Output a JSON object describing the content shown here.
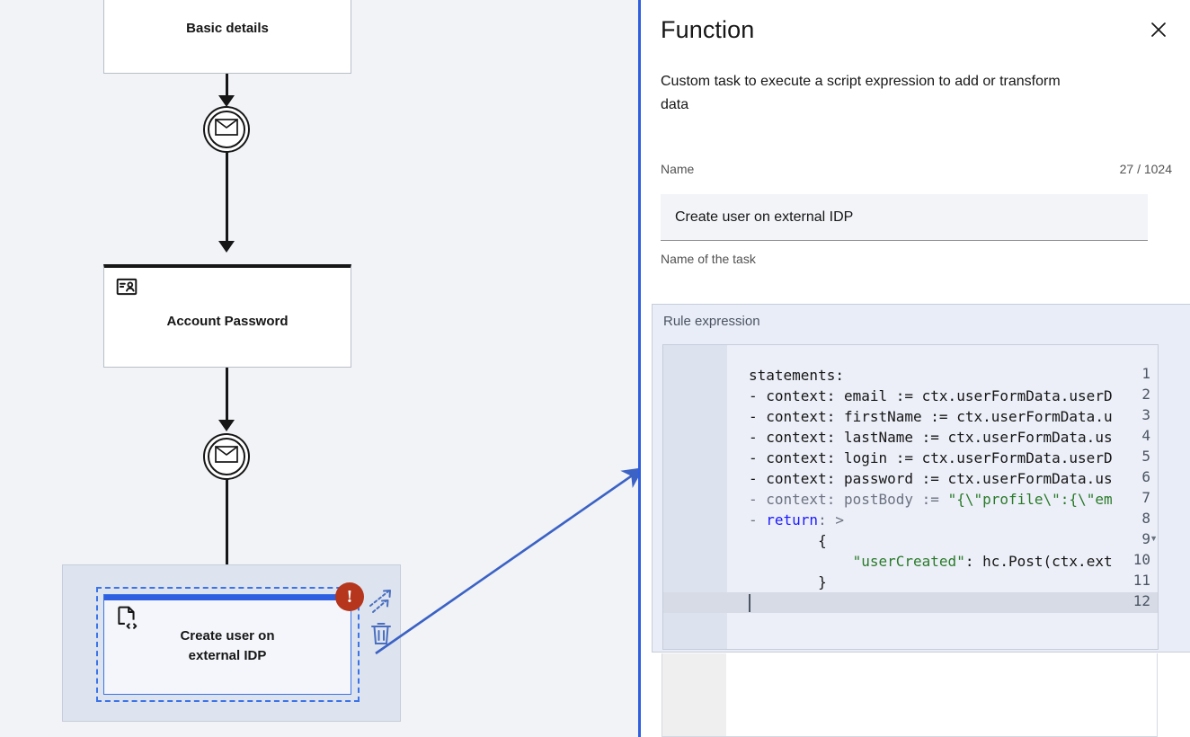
{
  "canvas": {
    "nodes": [
      {
        "id": "basic-details",
        "label": "Basic details",
        "icon": "user-task-icon"
      },
      {
        "id": "account-password",
        "label": "Account Password",
        "icon": "user-task-icon"
      },
      {
        "id": "create-user",
        "label": "Create user on\nexternal IDP",
        "label_line1": "Create user on",
        "label_line2": "external IDP",
        "icon": "script-task-icon"
      }
    ],
    "events": [
      {
        "id": "message-event-1",
        "icon": "envelope-icon"
      },
      {
        "id": "message-event-2",
        "icon": "envelope-icon"
      }
    ],
    "selected_node": {
      "error_badge": "!",
      "tools": [
        {
          "name": "connect-icon",
          "glyph": "connect"
        },
        {
          "name": "delete-icon",
          "glyph": "trash"
        }
      ]
    },
    "colors": {
      "background": "#f1f3f7",
      "selection_blue": "#3b73e8",
      "node_bar": "#2f5fe0",
      "error_red": "#b5361c",
      "tool_blue": "#4a6fbf"
    }
  },
  "panel": {
    "title": "Function",
    "close_label": "×",
    "description": "Custom task to execute a script expression to add or transform data",
    "name_field": {
      "label": "Name",
      "counter": "27 / 1024",
      "value": "Create user on external IDP",
      "placeholder": "",
      "helper": "Name of the task"
    },
    "rule_expression": {
      "label": "Rule expression",
      "active_line": 12,
      "lines": [
        {
          "n": 1,
          "text": "statements:",
          "fold": false
        },
        {
          "n": 2,
          "text": "- context: email := ctx.userFormData.userD",
          "fold": false
        },
        {
          "n": 3,
          "text": "- context: firstName := ctx.userFormData.u",
          "fold": false
        },
        {
          "n": 4,
          "text": "- context: lastName := ctx.userFormData.us",
          "fold": false
        },
        {
          "n": 5,
          "text": "- context: login := ctx.userFormData.userD",
          "fold": false
        },
        {
          "n": 6,
          "text": "- context: password := ctx.userFormData.us",
          "fold": false
        },
        {
          "n": 7,
          "text": "- context: postBody := \"{\\\"profile\\\":{\\\"em",
          "fold": false
        },
        {
          "n": 8,
          "text": "- return: >",
          "fold": false
        },
        {
          "n": 9,
          "text": "        {",
          "fold": true
        },
        {
          "n": 10,
          "text": "            \"userCreated\": hc.Post(ctx.ext",
          "fold": false
        },
        {
          "n": 11,
          "text": "        }",
          "fold": false
        },
        {
          "n": 12,
          "text": "",
          "fold": false
        }
      ]
    },
    "colors": {
      "accent": "#2f5fe0",
      "editor_bg": "#eceff8",
      "gutter_bg": "#dde3ee",
      "string_green": "#2a7a2a",
      "keyword_blue": "#1a1aff"
    }
  }
}
